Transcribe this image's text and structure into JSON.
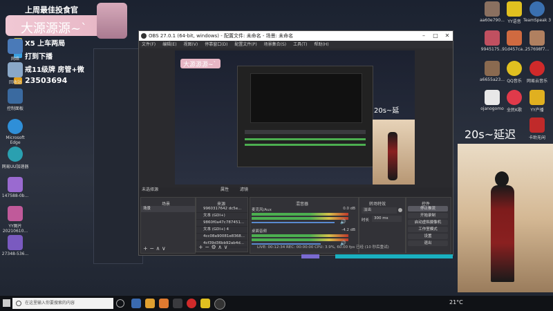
{
  "overlay": {
    "title": "上周最佳投食官",
    "streamer_name": "大源源源~`",
    "tasks": [
      {
        "label": "X5  上车两局",
        "color": "#d8c440"
      },
      {
        "label": "打到下播",
        "color": "#3aa0e0"
      },
      {
        "label": "戒11级牌  房管+微",
        "color": "#d07a30"
      },
      {
        "label": "23503694",
        "color": "#e0a020"
      }
    ]
  },
  "desktop_left_icons": [
    "网络",
    "回收站",
    "控制面板",
    "Microsoft Edge",
    "网易UU加速器",
    "147588-0b...",
    "YY图片\n20210610...",
    "27348-536..."
  ],
  "desktop_right_icons": [
    "aa60e790...",
    "YY语音",
    "TeamSpeak 3",
    "9945175...",
    "91d457ca...",
    "257698f7...",
    "a6655a23...",
    "QQ音乐",
    "网易云音乐",
    "ojanogomo",
    "全民K歌",
    "YY产播",
    "",
    "",
    "卡助无闲"
  ],
  "obs": {
    "window_title": "OBS 27.0.1 (64-bit, windows) - 配置文件: 未命名 - 场景: 未命名",
    "menu": [
      "文件(F)",
      "编辑(E)",
      "视图(V)",
      "停靠窗口(D)",
      "配置文件(P)",
      "场景集合(S)",
      "工具(T)",
      "帮助(H)"
    ],
    "inner_name": "大源源源~`",
    "inner_overlay": "20s~延",
    "no_source": "未选择源",
    "props_btn": "属性",
    "filter_btn": "滤镜",
    "docks": {
      "scenes": "场景",
      "sources": "来源",
      "mixer": "混音器",
      "transitions": "转场特效",
      "controls": "控件"
    },
    "scene_items": [
      "场景"
    ],
    "source_items": [
      "9960317642 dc5e...",
      "文本 (GDI+)",
      "9860f0a47c787451...",
      "文本 (GDI+) 4",
      "4cc08a90081e8368...",
      "4cf39d36bb92ab4d..."
    ],
    "mixer_tracks": [
      {
        "name": "麦克风/Aux",
        "db": "0.0 dB"
      },
      {
        "name": "桌面音频",
        "db": "-4.2 dB"
      }
    ],
    "transition": {
      "type": "淡出",
      "duration_label": "时长",
      "duration": "300 ms"
    },
    "controls": [
      "停止推流",
      "开始录制",
      "启动虚拟摄像机",
      "工作室模式",
      "设置",
      "退出"
    ],
    "status": "LIVE: 00:12:34   REC: 00:00:00   CPU: 3.9%, 60.00 fps   已经 (10 秒后重试)"
  },
  "cam_overlay_text": "20s~延迟",
  "taskbar": {
    "search_placeholder": "在这里输入你要搜索的内容",
    "weather": "21°C"
  }
}
